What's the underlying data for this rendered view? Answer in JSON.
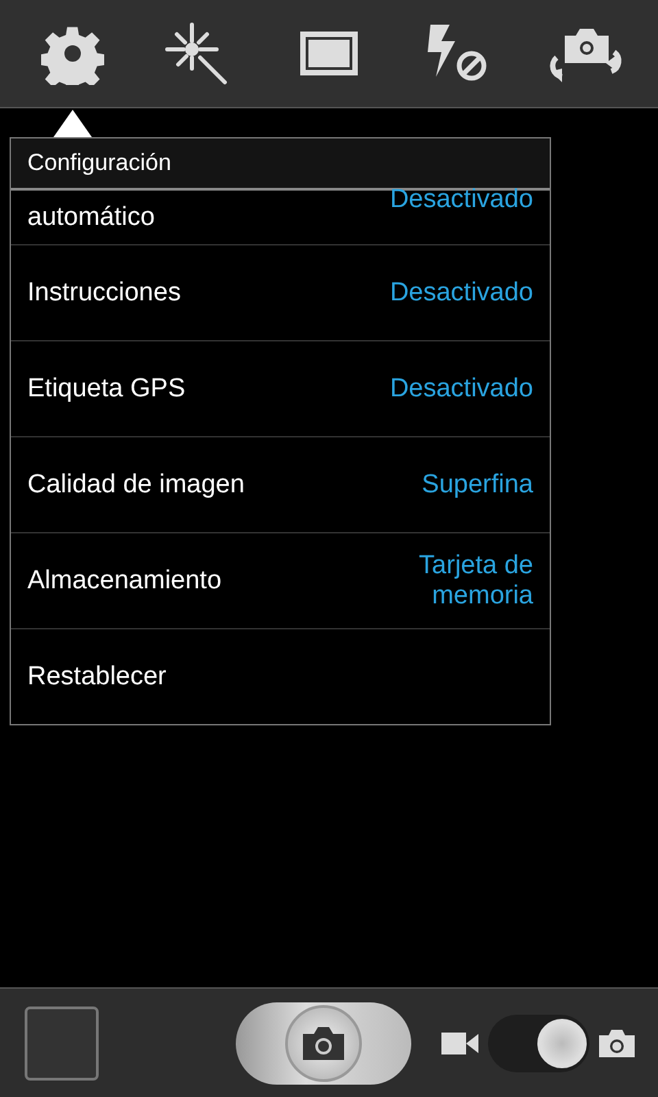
{
  "toolbar": [
    {
      "selected": true
    },
    {
      "selected": false
    },
    {
      "selected": false
    },
    {
      "selected": false
    },
    {
      "selected": false
    }
  ],
  "settings": {
    "title": "Configuración",
    "rows": [
      {
        "label": "automático",
        "value": "Desactivado"
      },
      {
        "label": "Instrucciones",
        "value": "Desactivado"
      },
      {
        "label": "Etiqueta GPS",
        "value": "Desactivado"
      },
      {
        "label": "Calidad de imagen",
        "value": "Superfina"
      },
      {
        "label": "Almacenamiento",
        "value": "Tarjeta de memoria"
      },
      {
        "label": "Restablecer"
      }
    ]
  },
  "bottom": {
    "camera_selected": true
  }
}
